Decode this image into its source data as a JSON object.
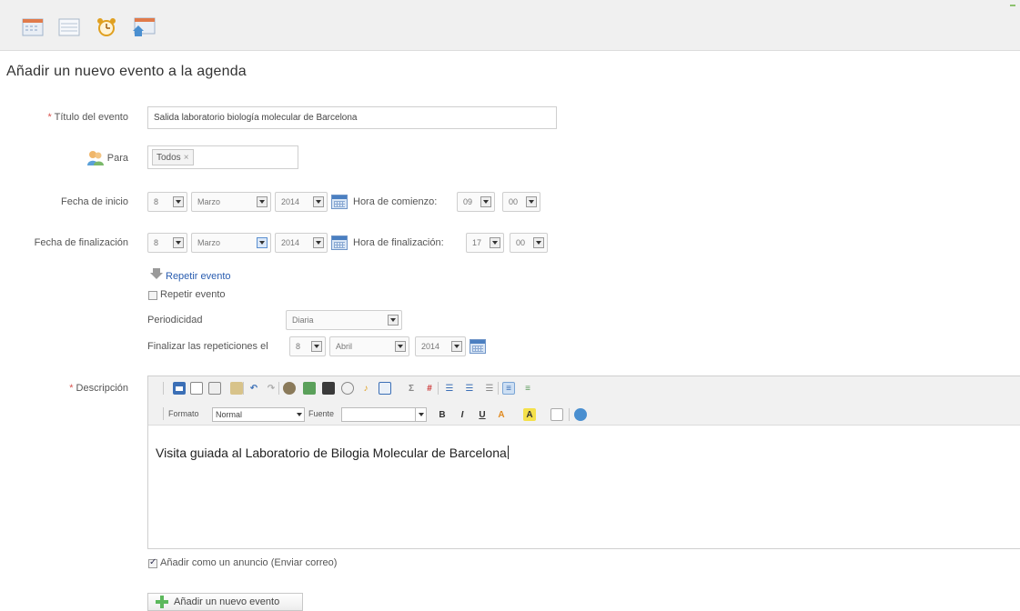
{
  "toolbar": {
    "icons": [
      "calendar-icon",
      "list-icon",
      "alarm-clock-icon",
      "home-calendar-icon"
    ]
  },
  "page_title": "Añadir un nuevo evento a la agenda",
  "form": {
    "required_mark": "*",
    "title_label": "Título del evento",
    "title_value": "Salida laboratorio biología molecular de Barcelona",
    "para_label": "Para",
    "para_token": "Todos",
    "para_token_remove": "×",
    "start_label": "Fecha de inicio",
    "start_day": "8",
    "start_month": "Marzo",
    "start_year": "2014",
    "start_time_label": "Hora de comienzo:",
    "start_hour": "09",
    "start_min": "00",
    "end_label": "Fecha de finalización",
    "end_day": "8",
    "end_month": "Marzo",
    "end_year": "2014",
    "end_time_label": "Hora de finalización:",
    "end_hour": "17",
    "end_min": "00",
    "repeat_link": "Repetir evento",
    "repeat_checkbox_label": "Repetir evento",
    "periodicity_label": "Periodicidad",
    "periodicity_value": "Diaria",
    "end_repeat_label": "Finalizar las repeticiones el",
    "end_repeat_day": "8",
    "end_repeat_month": "Abril",
    "end_repeat_year": "2014",
    "description_label": "Descripción",
    "description_text": "Visita guiada al Laboratorio de Bilogia Molecular de Barcelona",
    "announce_label": "Añadir como un anuncio (Enviar correo)",
    "announce_checked": true,
    "submit_label": "Añadir un nuevo evento"
  },
  "editor": {
    "format_label": "Formato",
    "format_value": "Normal",
    "font_label": "Fuente",
    "font_value": "",
    "bold": "B",
    "italic": "I",
    "underline": "U",
    "text_color": "A",
    "bg_color": "A"
  },
  "colors": {
    "accent_link": "#2a5db0",
    "required": "#d9534f",
    "add_icon": "#5cb85c"
  }
}
